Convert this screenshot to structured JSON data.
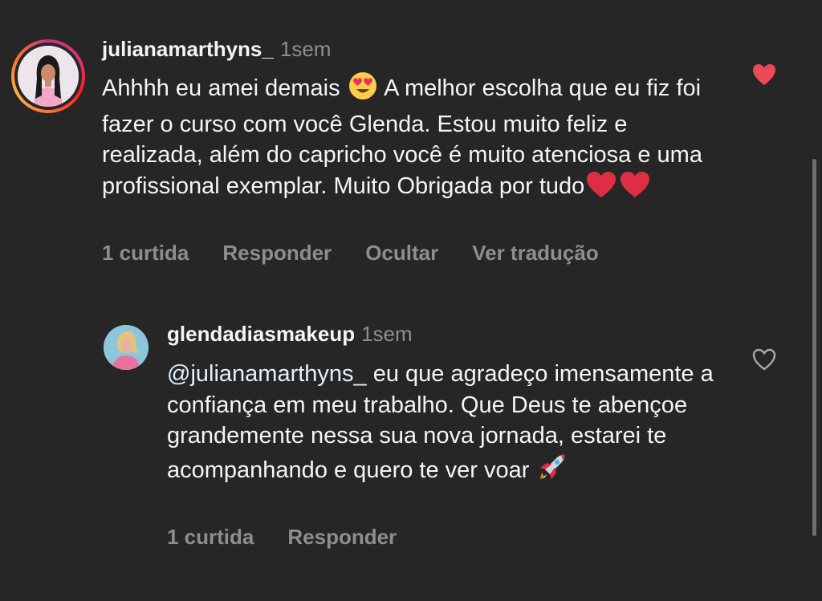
{
  "comment": {
    "username": "julianamarthyns_",
    "time": "1sem",
    "text_part1": "Ahhhh eu amei demais ",
    "text_part2": " A melhor escolha que eu fiz foi fazer o curso com você Glenda. Estou muito feliz e realizada, além do capricho você é muito atenciosa e uma profissional exemplar. Muito Obrigada por tudo",
    "liked": true,
    "actions": {
      "likes": "1 curtida",
      "reply": "Responder",
      "hide": "Ocultar",
      "translate": "Ver tradução"
    }
  },
  "reply": {
    "username": "glendadiasmakeup",
    "time": "1sem",
    "mention": "@julianamarthyns_",
    "text": " eu que agradeço imensamente a confiança em meu trabalho. Que Deus te abençoe grandemente nessa sua nova jornada, estarei te acompanhando e quero te ver voar ",
    "liked": false,
    "actions": {
      "likes": "1 curtida",
      "reply": "Responder"
    }
  },
  "icons": {
    "like_filled": "heart-filled-icon",
    "like_outline": "heart-outline-icon",
    "emoji_love": "heart-eyes-emoji",
    "emoji_heart": "red-heart-emoji",
    "emoji_rocket": "rocket-emoji"
  },
  "colors": {
    "background": "#262626",
    "text": "#f5f5f5",
    "muted": "#8e8e8e",
    "like": "#ed4956"
  }
}
